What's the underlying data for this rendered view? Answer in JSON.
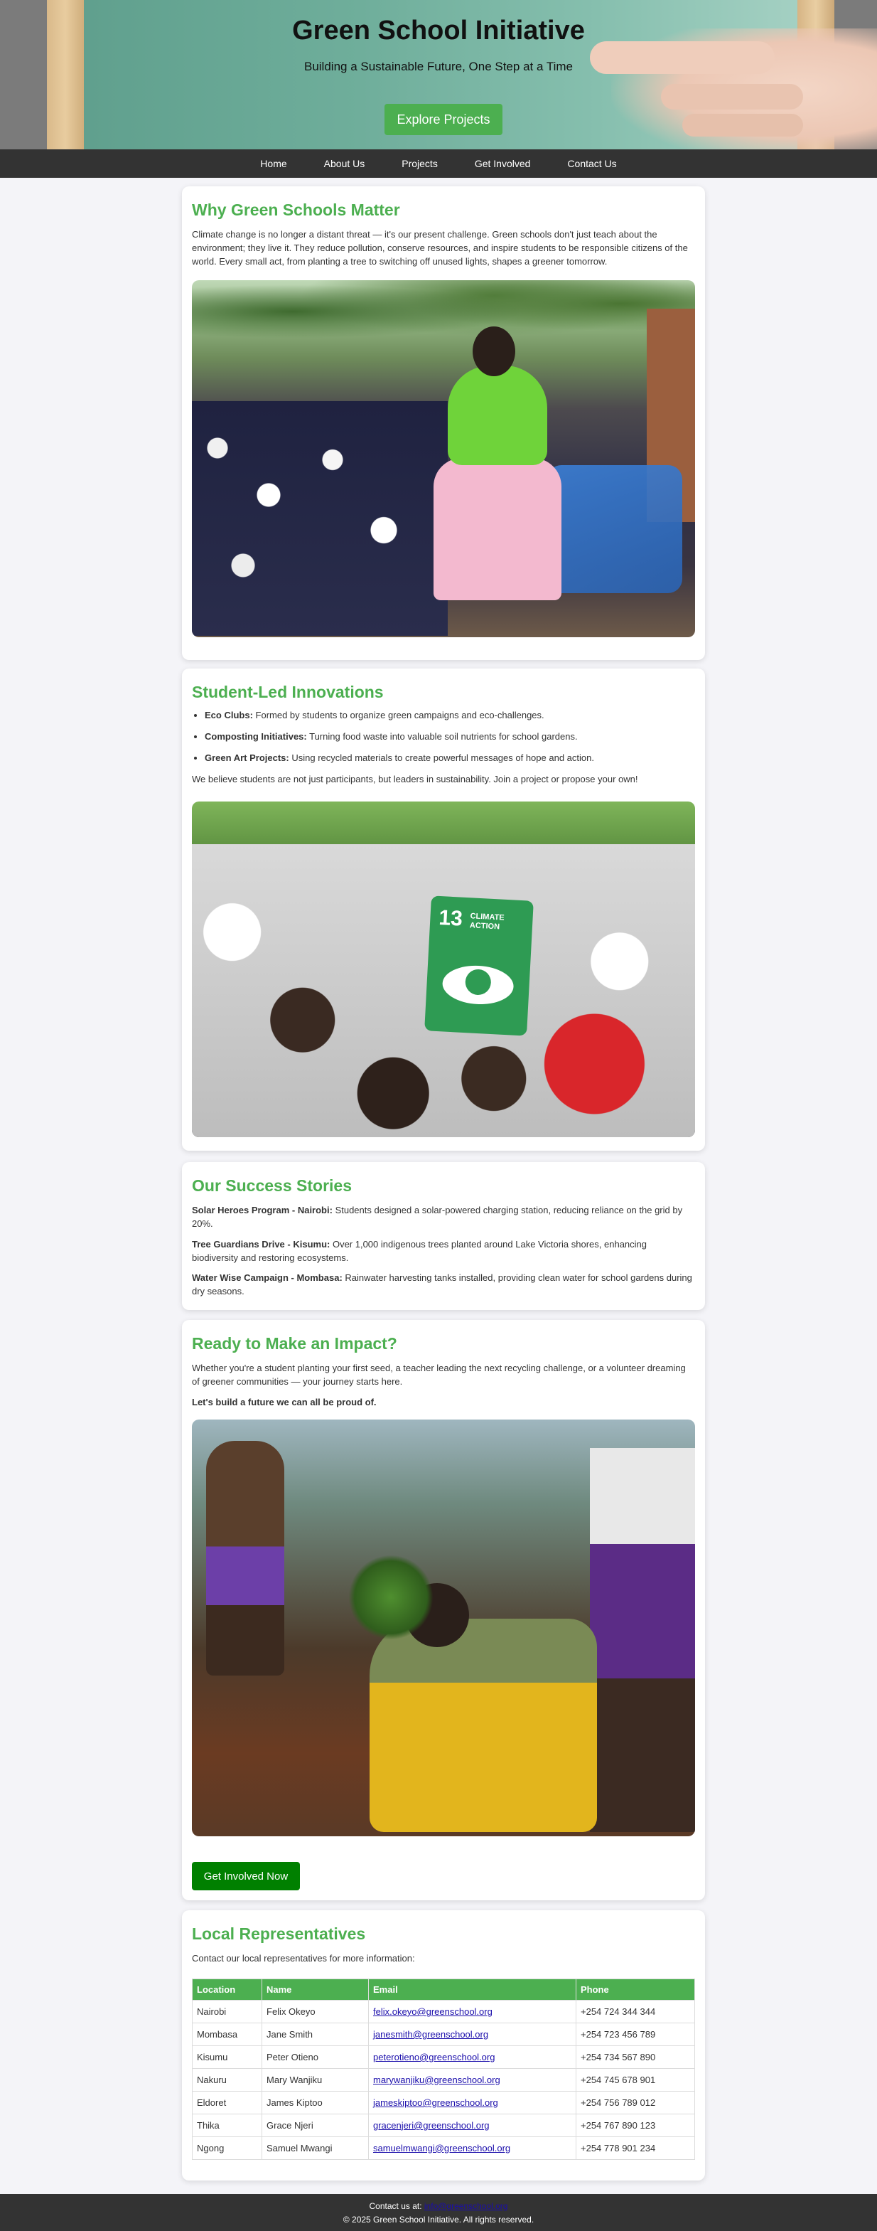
{
  "hero": {
    "title": "Green School Initiative",
    "subtitle": "Building a Sustainable Future, One Step at a Time",
    "cta_label": "Explore Projects"
  },
  "nav": {
    "items": [
      "Home",
      "About Us",
      "Projects",
      "Get Involved",
      "Contact Us"
    ]
  },
  "why": {
    "heading": "Why Green Schools Matter",
    "paragraph": "Climate change is no longer a distant threat — it's our present challenge. Green schools don't just teach about the environment; they live it. They reduce pollution, conserve resources, and inspire students to be responsible citizens of the world. Every small act, from planting a tree to switching off unused lights, shapes a greener tomorrow."
  },
  "innovations": {
    "heading": "Student-Led Innovations",
    "items": [
      {
        "title": "Eco Clubs:",
        "text": " Formed by students to organize green campaigns and eco-challenges."
      },
      {
        "title": "Composting Initiatives:",
        "text": " Turning food waste into valuable soil nutrients for school gardens."
      },
      {
        "title": "Green Art Projects:",
        "text": " Using recycled materials to create powerful messages of hope and action."
      }
    ],
    "paragraph": "We believe students are not just participants, but leaders in sustainability. Join a project or propose your own!",
    "sign_number": "13",
    "sign_text_1": "CLIMATE",
    "sign_text_2": "ACTION"
  },
  "success": {
    "heading": "Our Success Stories",
    "stories": [
      {
        "title": "Solar Heroes Program - Nairobi:",
        "text": " Students designed a solar-powered charging station, reducing reliance on the grid by 20%."
      },
      {
        "title": "Tree Guardians Drive - Kisumu:",
        "text": " Over 1,000 indigenous trees planted around Lake Victoria shores, enhancing biodiversity and restoring ecosystems."
      },
      {
        "title": "Water Wise Campaign - Mombasa:",
        "text": " Rainwater harvesting tanks installed, providing clean water for school gardens during dry seasons."
      }
    ]
  },
  "impact": {
    "heading": "Ready to Make an Impact?",
    "paragraph": "Whether you're a student planting your first seed, a teacher leading the next recycling challenge, or a volunteer dreaming of greener communities — your journey starts here.",
    "bold_line": "Let's build a future we can all be proud of.",
    "cta_label": "Get Involved Now"
  },
  "reps": {
    "heading": "Local Representatives",
    "intro": "Contact our local representatives for more information:",
    "columns": [
      "Location",
      "Name",
      "Email",
      "Phone"
    ],
    "rows": [
      [
        "Nairobi",
        "Felix Okeyo",
        "felix.okeyo@greenschool.org",
        "+254 724 344 344"
      ],
      [
        "Mombasa",
        "Jane Smith",
        "janesmith@greenschool.org",
        "+254 723 456 789"
      ],
      [
        "Kisumu",
        "Peter Otieno",
        "peterotieno@greenschool.org",
        "+254 734 567 890"
      ],
      [
        "Nakuru",
        "Mary Wanjiku",
        "marywanjiku@greenschool.org",
        "+254 745 678 901"
      ],
      [
        "Eldoret",
        "James Kiptoo",
        "jameskiptoo@greenschool.org",
        "+254 756 789 012"
      ],
      [
        "Thika",
        "Grace Njeri",
        "gracenjeri@greenschool.org",
        "+254 767 890 123"
      ],
      [
        "Ngong",
        "Samuel Mwangi",
        "samuelmwangi@greenschool.org",
        "+254 778 901 234"
      ]
    ]
  },
  "footer": {
    "contact_prefix": "Contact us at: ",
    "contact_email": "info@greenschool.org",
    "copyright": "© 2025 Green School Initiative. All rights reserved."
  },
  "colors": {
    "accent": "#4caf50",
    "dark": "#333333",
    "cta": "#008000"
  }
}
